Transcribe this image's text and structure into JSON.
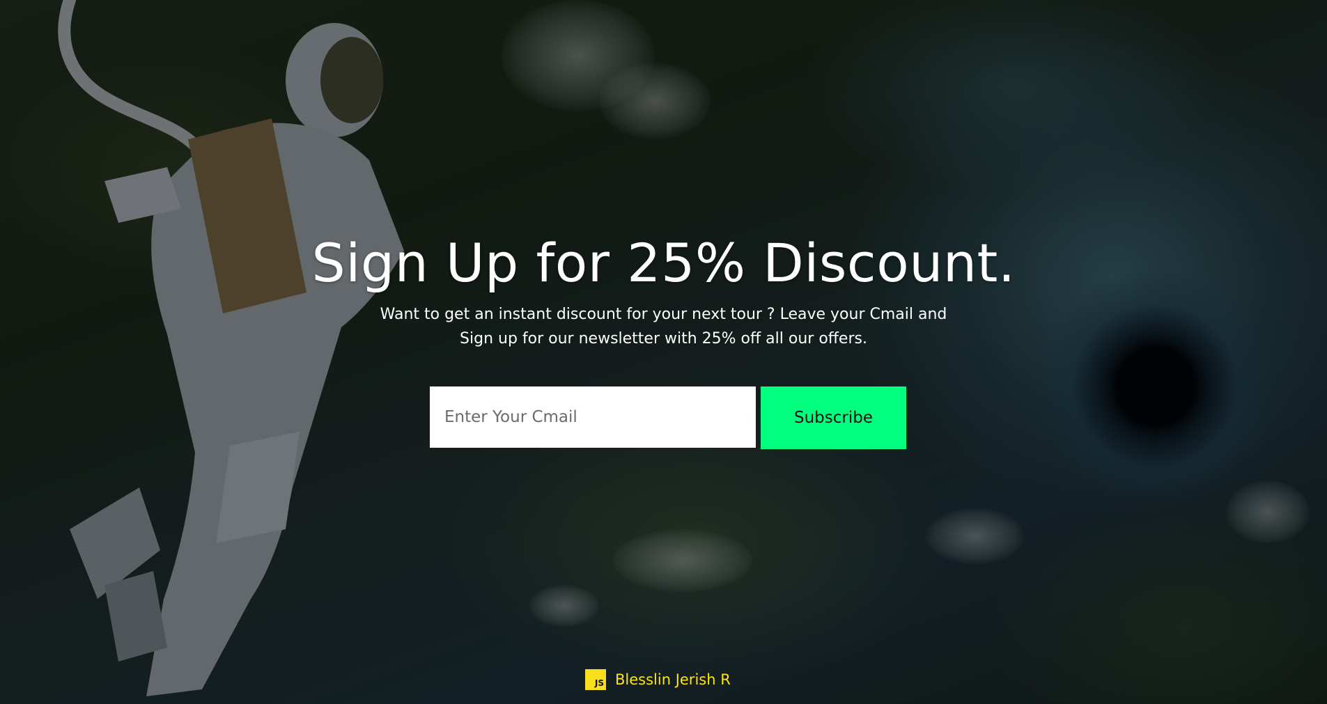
{
  "hero": {
    "heading": "Sign Up for 25% Discount.",
    "subtext_line1": "Want to get an instant discount for your next tour ? Leave your Cmail and",
    "subtext_line2": "Sign up for our newsletter with 25% off all our offers."
  },
  "form": {
    "email_placeholder": "Enter Your Cmail",
    "email_value": "",
    "subscribe_label": "Subscribe"
  },
  "footer": {
    "badge_text": "JS",
    "credit_name": "Blesslin Jerish R"
  },
  "colors": {
    "button_background": "#00ff7f",
    "credit_text": "#ffe600",
    "badge_background": "#f7df1e",
    "heading_text": "#ffffff"
  },
  "icons": {
    "credit_badge": "javascript-logo-icon"
  }
}
